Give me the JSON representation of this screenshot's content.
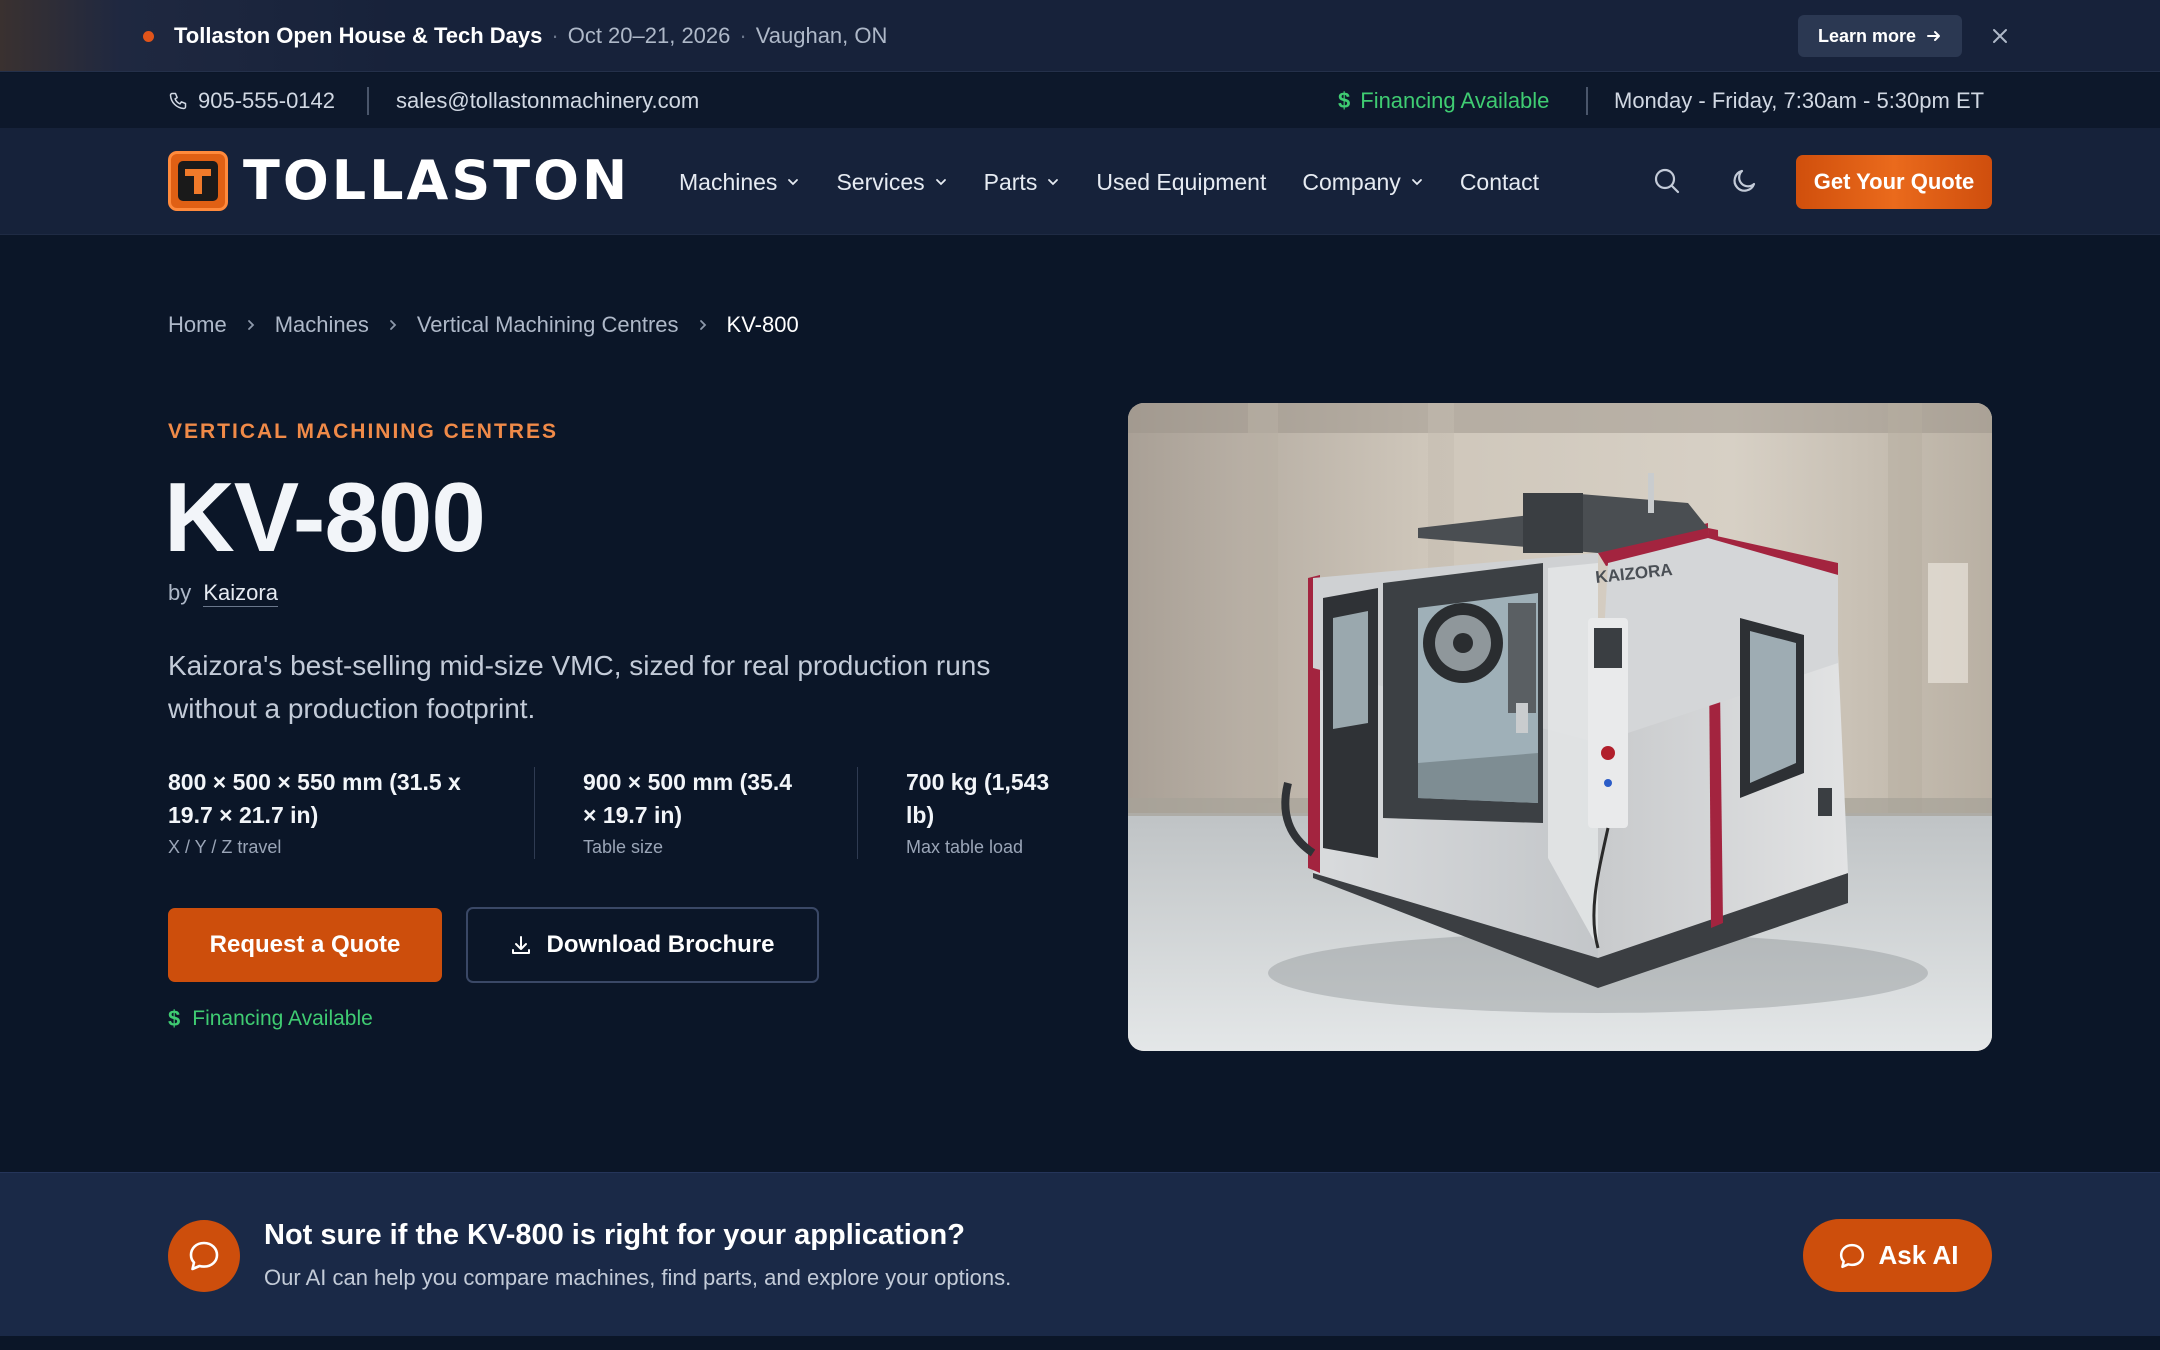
{
  "announcement": {
    "title": "Tollaston Open House & Tech Days",
    "dates": "Oct 20–21, 2026",
    "location": "Vaughan, ON",
    "learn_more": "Learn more",
    "dot_color": "#e0541a"
  },
  "contact_bar": {
    "phone": "905-555-0142",
    "email": "sales@tollastonmachinery.com",
    "financing": "Financing Available",
    "hours": "Monday - Friday, 7:30am - 5:30pm ET"
  },
  "nav": {
    "logo_text": "TOLLASTON",
    "items": [
      {
        "label": "Machines",
        "dropdown": true
      },
      {
        "label": "Services",
        "dropdown": true
      },
      {
        "label": "Parts",
        "dropdown": true
      },
      {
        "label": "Used Equipment",
        "dropdown": false
      },
      {
        "label": "Company",
        "dropdown": true
      },
      {
        "label": "Contact",
        "dropdown": false
      }
    ],
    "icons": [
      "search-icon",
      "moon-icon"
    ],
    "cta": "Get Your Quote"
  },
  "breadcrumb": [
    "Home",
    "Machines",
    "Vertical Machining Centres",
    "KV-800"
  ],
  "product": {
    "category": "VERTICAL MACHINING CENTRES",
    "model": "KV-800",
    "by": "by",
    "brand": "Kaizora",
    "tagline": "Kaizora's best-selling mid-size VMC, sized for real production runs without a production footprint.",
    "specs": [
      {
        "value": "800 × 500 × 550 mm (31.5 x 19.7 × 21.7 in)",
        "label": "X / Y / Z travel"
      },
      {
        "value": "900 × 500 mm (35.4 × 19.7 in)",
        "label": "Table size"
      },
      {
        "value": "700 kg (1,543 lb)",
        "label": "Max table load"
      }
    ],
    "request_quote": "Request a Quote",
    "download_brochure": "Download Brochure",
    "financing": "Financing Available",
    "image_brand_text": "KAIZORA"
  },
  "ai_strip": {
    "heading": "Not sure if the KV-800 is right for your application?",
    "subtext": "Our AI can help you compare machines, find parts, and explore your options.",
    "button": "Ask AI"
  },
  "colors": {
    "accent": "#cd4e0c",
    "background": "#0b1628",
    "financing_green": "#3fcc72",
    "eyebrow": "#f08a48"
  }
}
